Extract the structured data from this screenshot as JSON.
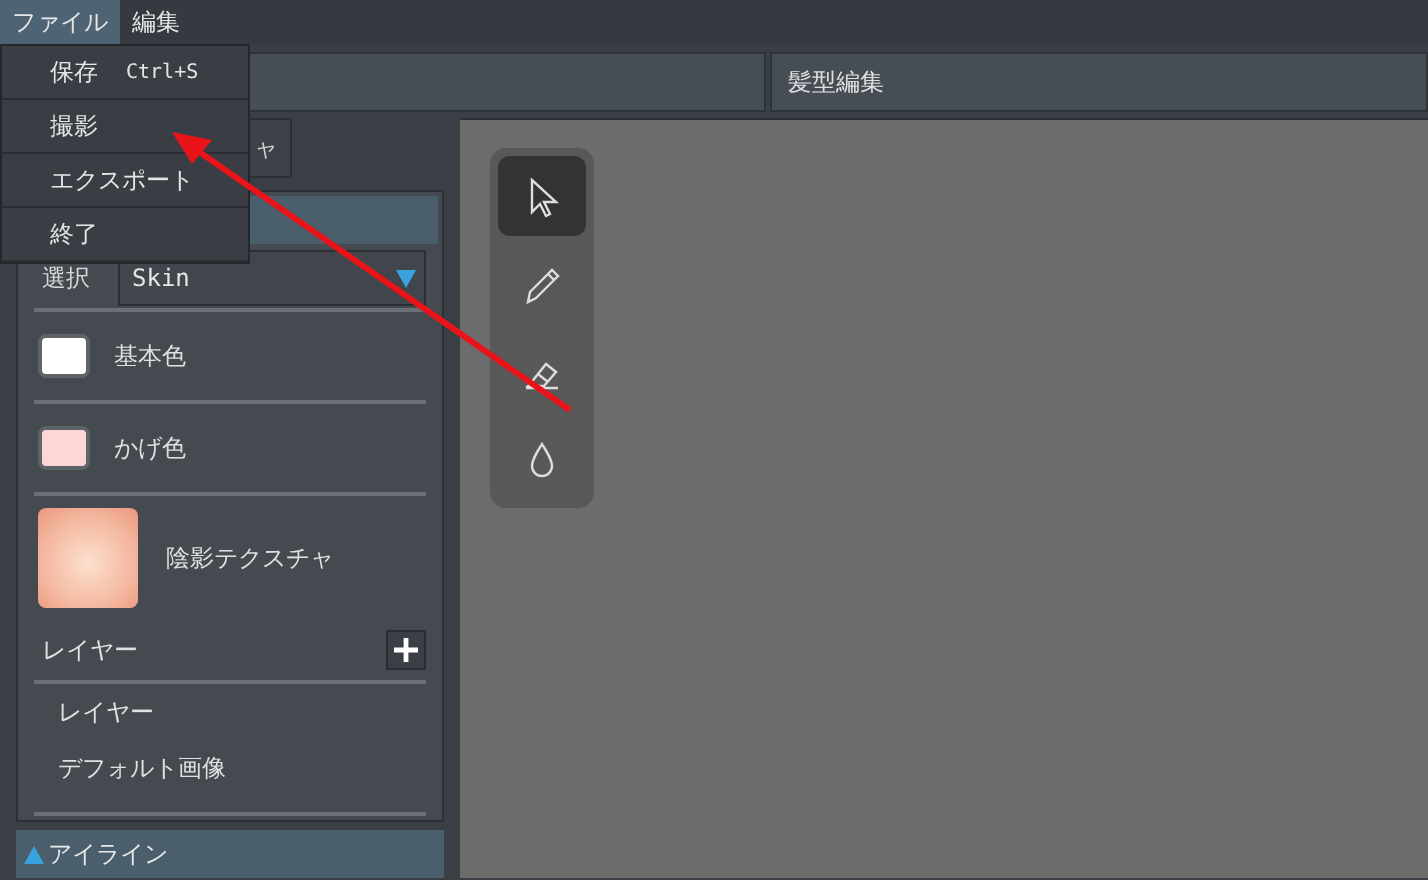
{
  "menu_bar": [
    {
      "label": "ファイル",
      "selected": true
    },
    {
      "label": "編集",
      "selected": false
    }
  ],
  "file_menu": [
    {
      "label": "保存",
      "shortcut": "Ctrl+S"
    },
    {
      "label": "撮影"
    },
    {
      "label": "エクスポート"
    },
    {
      "label": "終了"
    }
  ],
  "hair_editor_tab": {
    "label": "髪型編集"
  },
  "texture_tab": {
    "label": "ャ"
  },
  "select": {
    "label": "選択",
    "value": "Skin"
  },
  "colors": [
    {
      "label": "基本色",
      "color": "#ffffff"
    },
    {
      "label": "かげ色",
      "color": "#ffd6d8"
    }
  ],
  "texture": {
    "label": "陰影テクスチャ"
  },
  "layers": {
    "title": "レイヤー",
    "items": [
      "レイヤー",
      "デフォルト画像"
    ]
  },
  "footer_section": {
    "label": "アイライン",
    "expanded": false
  },
  "tools": [
    {
      "kind": "pointer",
      "selected": true
    },
    {
      "kind": "pencil",
      "selected": false
    },
    {
      "kind": "eraser",
      "selected": false
    },
    {
      "kind": "drop",
      "selected": false
    }
  ]
}
